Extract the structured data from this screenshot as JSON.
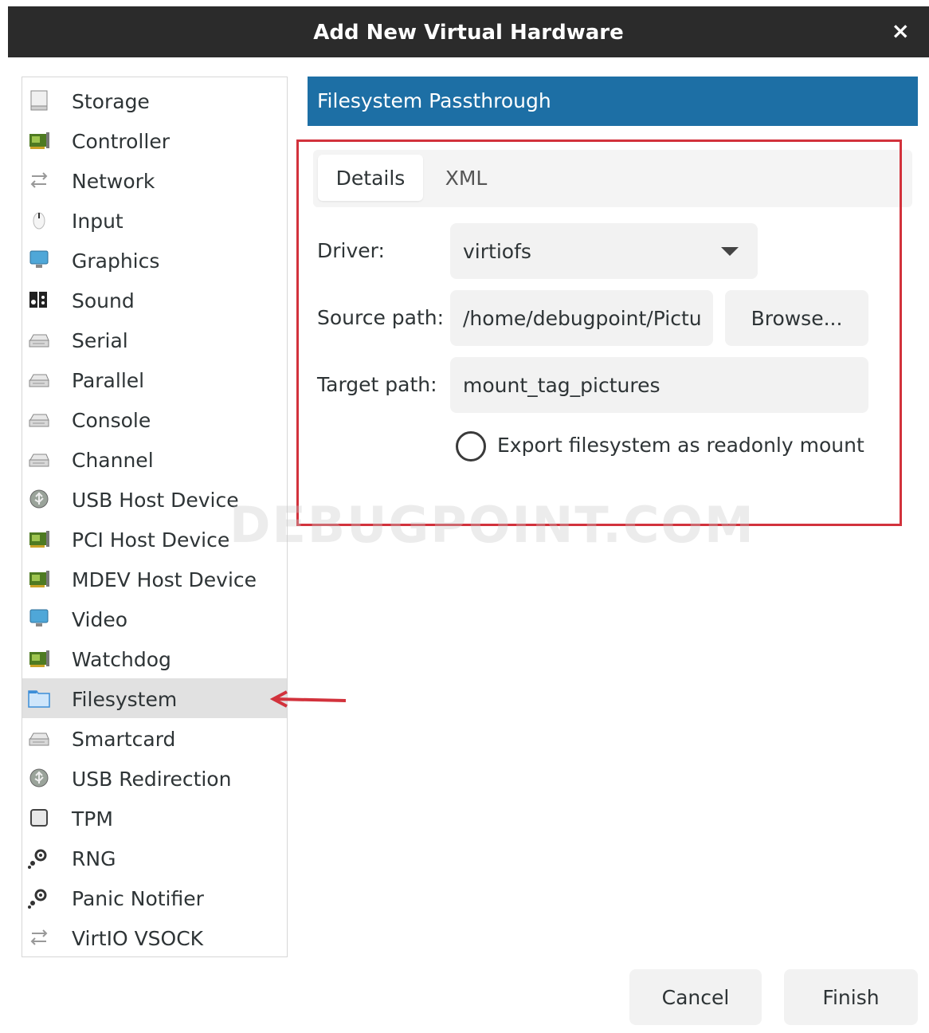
{
  "window": {
    "title": "Add New Virtual Hardware",
    "close_label": "×"
  },
  "sidebar": {
    "items": [
      {
        "label": "Storage",
        "icon": "storage-icon"
      },
      {
        "label": "Controller",
        "icon": "controller-icon"
      },
      {
        "label": "Network",
        "icon": "network-icon"
      },
      {
        "label": "Input",
        "icon": "input-icon"
      },
      {
        "label": "Graphics",
        "icon": "graphics-icon"
      },
      {
        "label": "Sound",
        "icon": "sound-icon"
      },
      {
        "label": "Serial",
        "icon": "serial-icon"
      },
      {
        "label": "Parallel",
        "icon": "parallel-icon"
      },
      {
        "label": "Console",
        "icon": "console-icon"
      },
      {
        "label": "Channel",
        "icon": "channel-icon"
      },
      {
        "label": "USB Host Device",
        "icon": "usb-icon"
      },
      {
        "label": "PCI Host Device",
        "icon": "pci-icon"
      },
      {
        "label": "MDEV Host Device",
        "icon": "mdev-icon"
      },
      {
        "label": "Video",
        "icon": "video-icon"
      },
      {
        "label": "Watchdog",
        "icon": "watchdog-icon"
      },
      {
        "label": "Filesystem",
        "icon": "folder-icon"
      },
      {
        "label": "Smartcard",
        "icon": "smartcard-icon"
      },
      {
        "label": "USB Redirection",
        "icon": "usb-redirection-icon"
      },
      {
        "label": "TPM",
        "icon": "tpm-icon"
      },
      {
        "label": "RNG",
        "icon": "rng-icon"
      },
      {
        "label": "Panic Notifier",
        "icon": "panic-notifier-icon"
      },
      {
        "label": "VirtIO VSOCK",
        "icon": "vsock-icon"
      }
    ],
    "selected": "Filesystem"
  },
  "main": {
    "header": "Filesystem Passthrough",
    "tabs": [
      {
        "label": "Details",
        "active": true
      },
      {
        "label": "XML",
        "active": false
      }
    ],
    "form": {
      "driver_label": "Driver:",
      "driver_value": "virtiofs",
      "source_label": "Source path:",
      "source_value": "/home/debugpoint/Pictu",
      "browse_label": "Browse...",
      "target_label": "Target path:",
      "target_value": "mount_tag_pictures",
      "readonly_label": "Export filesystem as readonly mount",
      "readonly_checked": false
    }
  },
  "footer": {
    "cancel_label": "Cancel",
    "finish_label": "Finish"
  },
  "watermark": "DEBUGPOINT.COM",
  "colors": {
    "titlebar": "#2b2b2b",
    "header_accent": "#1d6fa5",
    "highlight": "#d2323c",
    "selected_row": "#e1e1e1"
  }
}
